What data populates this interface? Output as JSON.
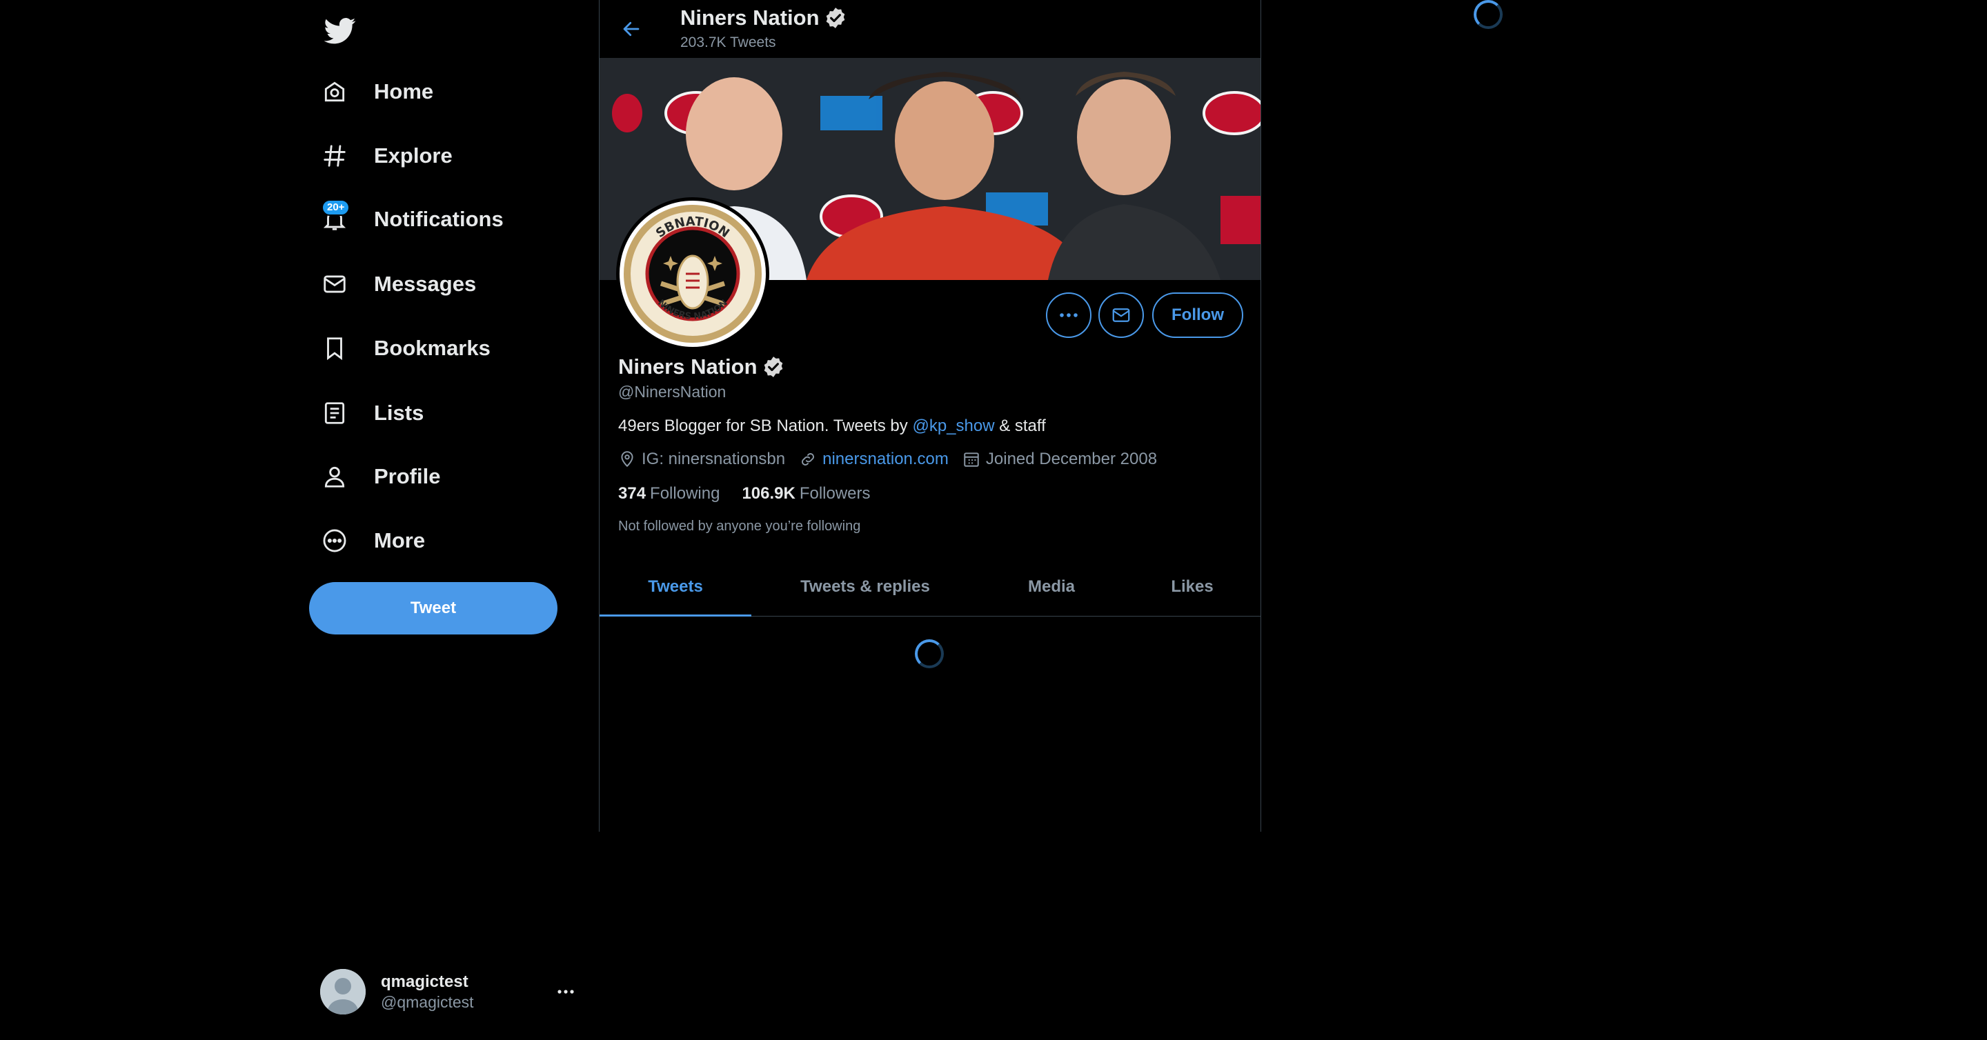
{
  "nav": {
    "items": [
      {
        "label": "Home"
      },
      {
        "label": "Explore"
      },
      {
        "label": "Notifications",
        "badge": "20+"
      },
      {
        "label": "Messages"
      },
      {
        "label": "Bookmarks"
      },
      {
        "label": "Lists"
      },
      {
        "label": "Profile"
      },
      {
        "label": "More"
      }
    ],
    "tweet_button": "Tweet"
  },
  "account": {
    "name": "qmagictest",
    "handle": "@qmagictest"
  },
  "header": {
    "name": "Niners Nation",
    "tweet_count": "203.7K Tweets"
  },
  "profile": {
    "name": "Niners Nation",
    "handle": "@NinersNation",
    "bio_prefix": "49ers Blogger for SB Nation. Tweets by ",
    "bio_mention": "@kp_show",
    "bio_suffix": " & staff",
    "location": "IG: ninersnationsbn",
    "website": "ninersnation.com",
    "joined": "Joined December 2008",
    "following_count": "374",
    "following_label": "Following",
    "followers_count": "106.9K",
    "followers_label": "Followers",
    "not_followed": "Not followed by anyone you’re following",
    "follow_button": "Follow",
    "avatar_logo_top": "SBNATION",
    "avatar_logo_bottom": "NINERS NATION"
  },
  "tabs": [
    {
      "label": "Tweets",
      "active": true
    },
    {
      "label": "Tweets & replies"
    },
    {
      "label": "Media"
    },
    {
      "label": "Likes"
    }
  ],
  "colors": {
    "accent": "#4a99e9",
    "background": "#000000",
    "border": "#38444d",
    "muted_text": "#8b98a5"
  },
  "icons": [
    "twitter-bird-icon",
    "home-icon",
    "hashtag-icon",
    "bell-icon",
    "mail-icon",
    "bookmark-icon",
    "list-icon",
    "person-icon",
    "more-circle-icon",
    "back-arrow-icon",
    "verified-badge-icon",
    "ellipsis-icon",
    "location-pin-icon",
    "link-icon",
    "calendar-icon",
    "loading-spinner-icon"
  ]
}
